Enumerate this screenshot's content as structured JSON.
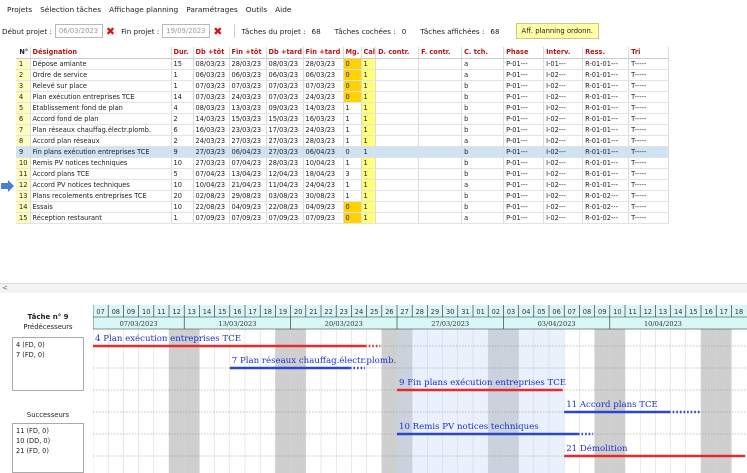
{
  "menu": [
    "Projets",
    "Sélection tâches",
    "Affichage planning",
    "Paramétrages",
    "Outils",
    "Aide"
  ],
  "toolbar": {
    "debut_label": "Début projet :",
    "debut_value": "06/03/2023",
    "fin_label": "Fin projet :",
    "fin_value": "19/09/2023",
    "taches_projet_label": "Tâches du projet :",
    "taches_projet_value": "68",
    "taches_cochees_label": "Tâches cochées :",
    "taches_cochees_value": "0",
    "taches_affichees_label": "Tâches affichées :",
    "taches_affichees_value": "68",
    "aff_button": "Aff. planning ordonn."
  },
  "table": {
    "columns": [
      "N°",
      "Désignation",
      "Dur.",
      "Db +tôt",
      "Fin +tôt",
      "Db +tard",
      "Fin +tard",
      "Mg.",
      "Cal",
      "D. contr.",
      "F. contr.",
      "C. tch.",
      "Phase",
      "Interv.",
      "Ress.",
      "Tri"
    ],
    "selected_row": 8,
    "rows": [
      [
        "1",
        "Dépose amiante",
        "15",
        "08/03/23",
        "28/03/23",
        "08/03/23",
        "28/03/23",
        "0",
        "1",
        "",
        "",
        "a",
        "P-01---",
        "I-01---",
        "R-01-01---",
        "T-----"
      ],
      [
        "2",
        "Ordre de service",
        "1",
        "06/03/23",
        "06/03/23",
        "06/03/23",
        "06/03/23",
        "0",
        "1",
        "",
        "",
        "a",
        "P-01---",
        "I-02---",
        "R-01-01---",
        "T-----"
      ],
      [
        "3",
        "Relevé sur place",
        "1",
        "07/03/23",
        "07/03/23",
        "07/03/23",
        "07/03/23",
        "0",
        "1",
        "",
        "",
        "b",
        "P-01---",
        "I-02---",
        "R-01-01---",
        "T-----"
      ],
      [
        "4",
        "Plan exécution entreprises TCE",
        "14",
        "07/03/23",
        "24/03/23",
        "07/03/23",
        "24/03/23",
        "0",
        "1",
        "",
        "",
        "b",
        "P-01---",
        "I-02---",
        "R-01-01---",
        "T-----"
      ],
      [
        "5",
        "Etablissement fond de plan",
        "4",
        "08/03/23",
        "13/03/23",
        "09/03/23",
        "14/03/23",
        "1",
        "1",
        "",
        "",
        "b",
        "P-01---",
        "I-02---",
        "R-01-01---",
        "T-----"
      ],
      [
        "6",
        "Accord fond de plan",
        "2",
        "14/03/23",
        "15/03/23",
        "15/03/23",
        "16/03/23",
        "1",
        "1",
        "",
        "",
        "b",
        "P-01---",
        "I-02---",
        "R-01-01---",
        "T-----"
      ],
      [
        "7",
        "Plan réseaux chauffag.électr.plomb.",
        "6",
        "16/03/23",
        "23/03/23",
        "17/03/23",
        "24/03/23",
        "1",
        "1",
        "",
        "",
        "b",
        "P-01---",
        "I-02---",
        "R-01-01---",
        "T-----"
      ],
      [
        "8",
        "Accord plan réseaux",
        "2",
        "24/03/23",
        "27/03/23",
        "27/03/23",
        "28/03/23",
        "1",
        "1",
        "",
        "",
        "a",
        "P-01---",
        "I-02---",
        "R-01-01---",
        "T-----"
      ],
      [
        "9",
        "Fin plans exécution entreprises TCE",
        "9",
        "27/03/23",
        "06/04/23",
        "27/03/23",
        "06/04/23",
        "0",
        "1",
        "",
        "",
        "b",
        "P-01---",
        "I-02---",
        "R-01-01---",
        "T-----"
      ],
      [
        "10",
        "Remis PV notices techniques",
        "10",
        "27/03/23",
        "07/04/23",
        "28/03/23",
        "10/04/23",
        "1",
        "1",
        "",
        "",
        "b",
        "P-01---",
        "I-02---",
        "R-01-01---",
        "T-----"
      ],
      [
        "11",
        "Accord plans TCE",
        "5",
        "07/04/23",
        "13/04/23",
        "12/04/23",
        "18/04/23",
        "3",
        "1",
        "",
        "",
        "b",
        "P-01---",
        "I-02---",
        "R-01-01---",
        "T-----"
      ],
      [
        "12",
        "Accord PV notices techniques",
        "10",
        "10/04/23",
        "21/04/23",
        "11/04/23",
        "24/04/23",
        "1",
        "1",
        "",
        "",
        "a",
        "P-01---",
        "I-02---",
        "R-01-01---",
        "T-----"
      ],
      [
        "13",
        "Plans recolements entreprises TCE",
        "20",
        "02/08/23",
        "29/08/23",
        "03/08/23",
        "30/08/23",
        "1",
        "1",
        "",
        "",
        "b",
        "P-01---",
        "I-02---",
        "R-01-02---",
        "T-----"
      ],
      [
        "14",
        "Essais",
        "10",
        "22/08/23",
        "04/09/23",
        "22/08/23",
        "04/09/23",
        "0",
        "1",
        "",
        "",
        "b",
        "P-01---",
        "I-02---",
        "R-01-02---",
        "T-----"
      ],
      [
        "15",
        "Réception restaurant",
        "1",
        "07/09/23",
        "07/09/23",
        "07/09/23",
        "07/09/23",
        "0",
        "1",
        "",
        "",
        "a",
        "P-01---",
        "I-02---",
        "R-01-02---",
        "T-----"
      ]
    ]
  },
  "task_panel": {
    "title": "Tâche n° 9",
    "predecessors_label": "Prédécesseurs",
    "predecessors": [
      "4  (FD, 0)",
      "7  (FD, 0)"
    ],
    "successors_label": "Successeurs",
    "successors": [
      "11  (FD, 0)",
      "10  (DD, 0)",
      "21  (FD, 0)"
    ]
  },
  "gantt": {
    "days": [
      "07",
      "08",
      "09",
      "10",
      "11",
      "12",
      "13",
      "14",
      "15",
      "16",
      "17",
      "18",
      "19",
      "20",
      "21",
      "22",
      "23",
      "24",
      "25",
      "26",
      "27",
      "28",
      "29",
      "30",
      "31",
      "01",
      "02",
      "03",
      "04",
      "05",
      "06",
      "07",
      "08",
      "09",
      "10",
      "11",
      "12",
      "13",
      "14",
      "15",
      "16",
      "17",
      "18"
    ],
    "weeks": [
      {
        "label": "07/03/2023",
        "start": 0
      },
      {
        "label": "13/03/2023",
        "start": 6
      },
      {
        "label": "20/03/2023",
        "start": 13
      },
      {
        "label": "27/03/2023",
        "start": 20
      },
      {
        "label": "03/04/2023",
        "start": 27
      },
      {
        "label": "10/04/2023",
        "start": 34
      }
    ],
    "weekend_days": [
      5,
      6,
      12,
      13,
      19,
      20,
      26,
      27,
      33,
      34,
      40,
      41
    ],
    "tasks": [
      {
        "label": "4 Plan exécution entreprises TCE",
        "start": 0,
        "end": 17.9,
        "dots_end": 18.9,
        "lane": 0,
        "color": "#e52b2b"
      },
      {
        "label": "7 Plan réseaux chauffag.électr.plomb.",
        "start": 9,
        "end": 16.9,
        "dots_end": 17.9,
        "lane": 1,
        "color": "#2b46c9"
      },
      {
        "label": "9 Fin plans exécution entreprises TCE",
        "start": 20,
        "end": 30.9,
        "dots_end": 30.9,
        "lane": 2,
        "color": "#e52b2b"
      },
      {
        "label": "11 Accord plans TCE",
        "start": 31,
        "end": 37.9,
        "dots_end": 39.9,
        "lane": 3,
        "color": "#2b46c9"
      },
      {
        "label": "10 Remis PV notices techniques",
        "start": 20,
        "end": 31.9,
        "dots_end": 32.9,
        "lane": 4,
        "color": "#2b46c9"
      },
      {
        "label": "21 Démolition",
        "start": 31,
        "end": 42.9,
        "dots_end": 42.9,
        "lane": 5,
        "color": "#e52b2b"
      }
    ]
  }
}
